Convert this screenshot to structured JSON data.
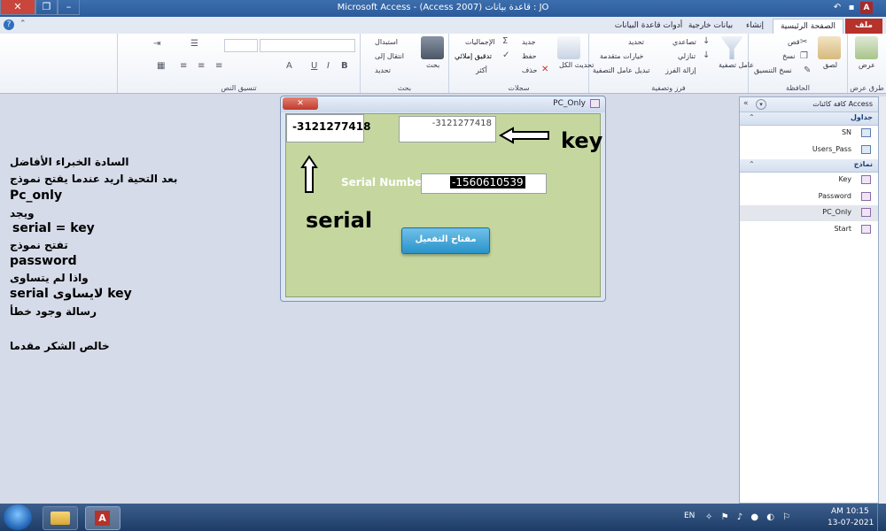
{
  "window": {
    "title": "Microsoft Access - (Access 2007) قاعدة بيانات : JO",
    "app_icon": "A"
  },
  "tabs": [
    {
      "label": "ملف",
      "state": "file"
    },
    {
      "label": "الصفحة الرئيسية",
      "state": "active"
    },
    {
      "label": "إنشاء",
      "state": "normal"
    },
    {
      "label": "بيانات خارجية",
      "state": "normal"
    },
    {
      "label": "أدوات قاعدة البيانات",
      "state": "normal"
    }
  ],
  "ribbon": {
    "views": {
      "label": "طرق عرض",
      "btn": "عرض"
    },
    "clipboard": {
      "label": "الحافظة",
      "paste": "لصق",
      "cut": "قص",
      "copy": "نسخ",
      "format_painter": "نسخ التنسيق"
    },
    "sort_filter": {
      "label": "فرز وتصفية",
      "filter": "عامل تصفية",
      "ascending": "تصاعدي",
      "descending": "تنازلي",
      "remove_sort": "إزالة الفرز",
      "selection": "تحديد",
      "advanced": "خيارات متقدمة",
      "toggle_filter": "تبديل عامل التصفية"
    },
    "records": {
      "label": "سجلات",
      "refresh": "تحديث الكل",
      "new": "جديد",
      "save": "حفظ",
      "delete": "حذف",
      "totals": "الإجماليات",
      "spelling": "تدقيق إملائي",
      "more": "أكثر"
    },
    "find": {
      "label": "بحث",
      "find": "بحث",
      "replace": "استبدال",
      "goto": "انتقال إلى",
      "select": "تحديد"
    },
    "text_format": {
      "label": "تنسيق النص"
    }
  },
  "nav": {
    "header": "كافة كائنات Access",
    "sections": [
      {
        "title": "جداول",
        "items": [
          "SN",
          "Users_Pass"
        ]
      },
      {
        "title": "نماذج",
        "items": [
          "Key",
          "Password",
          "PC_Only",
          "Start"
        ]
      }
    ],
    "selected": "PC_Only"
  },
  "note_lines": [
    "السادة الخبراء الأفاضل",
    "بعد التحية اريد عندما يفتح نموذج",
    "Pc_only",
    "ويجد",
    "serial = key",
    "تفتح نموذج",
    "password",
    "واذا لم يتساوى",
    "serial لايساوى key",
    "رسالة وجود خطأ",
    "خالص الشكر مقدما"
  ],
  "form": {
    "title": "PC_Only",
    "serial_box": "-3121277418",
    "key_box": "-3121277418",
    "serial_number_label": "Serial Number",
    "serial_number_value": "-1560610539",
    "key_annotation": "key",
    "serial_annotation": "serial",
    "activate_button": "مفتاح التفعيل"
  },
  "taskbar": {
    "lang": "EN",
    "time": "AM 10:15",
    "date": "13-07-2021"
  }
}
